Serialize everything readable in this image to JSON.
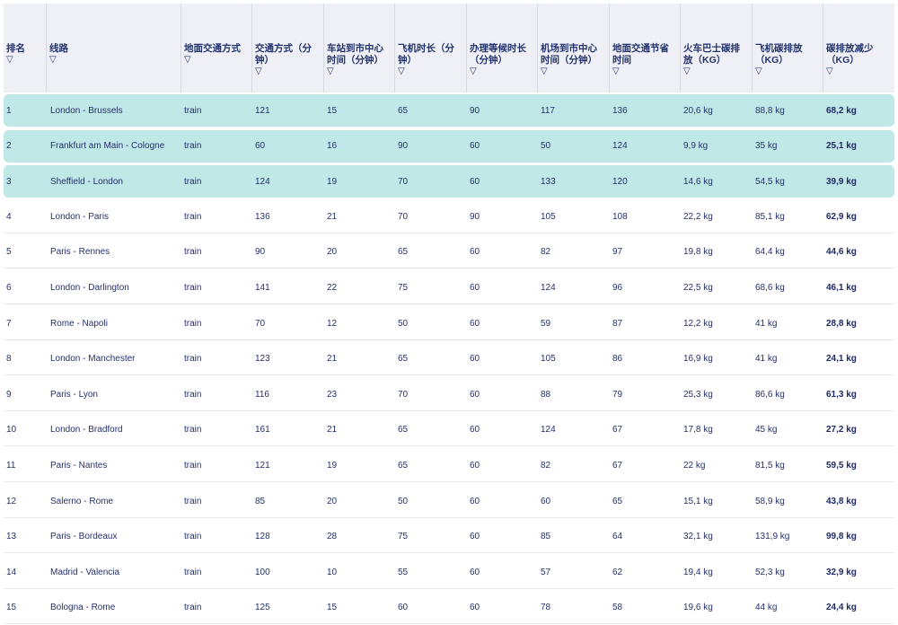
{
  "columns": [
    "排名",
    "线路",
    "地面交通方式",
    "交通方式（分钟）",
    "车站到市中心时间（分钟）",
    "飞机时长（分钟）",
    "办理等候时长（分钟）",
    "机场到市中心时间（分钟）",
    "地面交通节省时间",
    "火车巴士碳排放（KG）",
    "飞机碳排放（KG）",
    "碳排放减少（KG）"
  ],
  "sort_icon": "▽",
  "colors": {
    "highlight": "#bfe8e6",
    "header_bg": "#eef0f5",
    "text": "#1f2a55"
  },
  "rows": [
    {
      "rank": "1",
      "route": "London - Brussels",
      "mode": "train",
      "travel": "121",
      "station": "15",
      "flight": "65",
      "checkin": "90",
      "airport": "117",
      "saved": "136",
      "ground_co2": "20,6 kg",
      "plane_co2": "88,8 kg",
      "reduction": "68,2 kg",
      "highlight": true
    },
    {
      "rank": "2",
      "route": "Frankfurt am Main - Cologne",
      "mode": "train",
      "travel": "60",
      "station": "16",
      "flight": "90",
      "checkin": "60",
      "airport": "50",
      "saved": "124",
      "ground_co2": "9,9 kg",
      "plane_co2": "35 kg",
      "reduction": "25,1 kg",
      "highlight": true
    },
    {
      "rank": "3",
      "route": "Sheffield - London",
      "mode": "train",
      "travel": "124",
      "station": "19",
      "flight": "70",
      "checkin": "60",
      "airport": "133",
      "saved": "120",
      "ground_co2": "14,6 kg",
      "plane_co2": "54,5 kg",
      "reduction": "39,9 kg",
      "highlight": true
    },
    {
      "rank": "4",
      "route": "London - Paris",
      "mode": "train",
      "travel": "136",
      "station": "21",
      "flight": "70",
      "checkin": "90",
      "airport": "105",
      "saved": "108",
      "ground_co2": "22,2 kg",
      "plane_co2": "85,1 kg",
      "reduction": "62,9 kg",
      "highlight": false
    },
    {
      "rank": "5",
      "route": "Paris - Rennes",
      "mode": "train",
      "travel": "90",
      "station": "20",
      "flight": "65",
      "checkin": "60",
      "airport": "82",
      "saved": "97",
      "ground_co2": "19,8 kg",
      "plane_co2": "64,4 kg",
      "reduction": "44,6 kg",
      "highlight": false
    },
    {
      "rank": "6",
      "route": "London - Darlington",
      "mode": "train",
      "travel": "141",
      "station": "22",
      "flight": "75",
      "checkin": "60",
      "airport": "124",
      "saved": "96",
      "ground_co2": "22,5 kg",
      "plane_co2": "68,6 kg",
      "reduction": "46,1 kg",
      "highlight": false
    },
    {
      "rank": "7",
      "route": "Rome - Napoli",
      "mode": "train",
      "travel": "70",
      "station": "12",
      "flight": "50",
      "checkin": "60",
      "airport": "59",
      "saved": "87",
      "ground_co2": "12,2 kg",
      "plane_co2": "41 kg",
      "reduction": "28,8 kg",
      "highlight": false
    },
    {
      "rank": "8",
      "route": "London - Manchester",
      "mode": "train",
      "travel": "123",
      "station": "21",
      "flight": "65",
      "checkin": "60",
      "airport": "105",
      "saved": "86",
      "ground_co2": "16,9 kg",
      "plane_co2": "41 kg",
      "reduction": "24,1 kg",
      "highlight": false
    },
    {
      "rank": "9",
      "route": "Paris - Lyon",
      "mode": "train",
      "travel": "116",
      "station": "23",
      "flight": "70",
      "checkin": "60",
      "airport": "88",
      "saved": "79",
      "ground_co2": "25,3 kg",
      "plane_co2": "86,6 kg",
      "reduction": "61,3 kg",
      "highlight": false
    },
    {
      "rank": "10",
      "route": "London - Bradford",
      "mode": "train",
      "travel": "161",
      "station": "21",
      "flight": "65",
      "checkin": "60",
      "airport": "124",
      "saved": "67",
      "ground_co2": "17,8 kg",
      "plane_co2": "45 kg",
      "reduction": "27,2 kg",
      "highlight": false
    },
    {
      "rank": "11",
      "route": "Paris - Nantes",
      "mode": "train",
      "travel": "121",
      "station": "19",
      "flight": "65",
      "checkin": "60",
      "airport": "82",
      "saved": "67",
      "ground_co2": "22 kg",
      "plane_co2": "81,5 kg",
      "reduction": "59,5 kg",
      "highlight": false
    },
    {
      "rank": "12",
      "route": "Salerno - Rome",
      "mode": "train",
      "travel": "85",
      "station": "20",
      "flight": "50",
      "checkin": "60",
      "airport": "60",
      "saved": "65",
      "ground_co2": "15,1 kg",
      "plane_co2": "58,9 kg",
      "reduction": "43,8 kg",
      "highlight": false
    },
    {
      "rank": "13",
      "route": "Paris - Bordeaux",
      "mode": "train",
      "travel": "128",
      "station": "28",
      "flight": "75",
      "checkin": "60",
      "airport": "85",
      "saved": "64",
      "ground_co2": "32,1 kg",
      "plane_co2": "131,9 kg",
      "reduction": "99,8 kg",
      "highlight": false
    },
    {
      "rank": "14",
      "route": "Madrid - Valencia",
      "mode": "train",
      "travel": "100",
      "station": "10",
      "flight": "55",
      "checkin": "60",
      "airport": "57",
      "saved": "62",
      "ground_co2": "19,4 kg",
      "plane_co2": "52,3 kg",
      "reduction": "32,9 kg",
      "highlight": false
    },
    {
      "rank": "15",
      "route": "Bologna - Rome",
      "mode": "train",
      "travel": "125",
      "station": "15",
      "flight": "60",
      "checkin": "60",
      "airport": "78",
      "saved": "58",
      "ground_co2": "19,6 kg",
      "plane_co2": "44 kg",
      "reduction": "24,4 kg",
      "highlight": false
    }
  ]
}
